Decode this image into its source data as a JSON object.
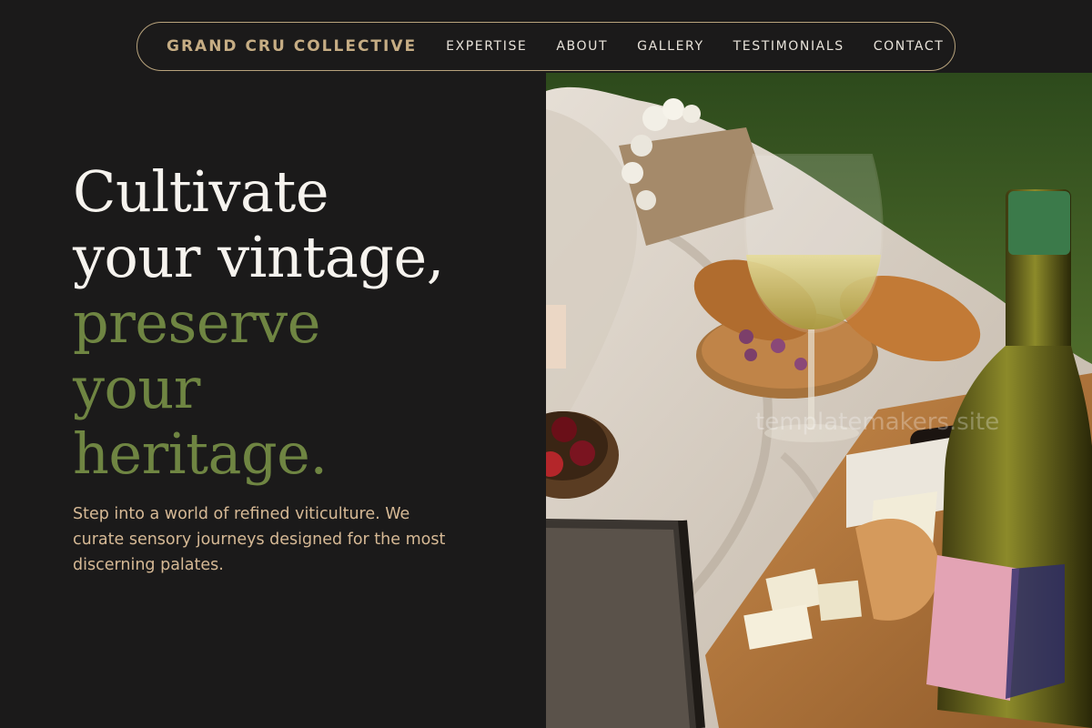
{
  "nav": {
    "brand": "GRAND CRU COLLECTIVE",
    "links": [
      "EXPERTISE",
      "ABOUT",
      "GALLERY",
      "TESTIMONIALS",
      "CONTACT"
    ]
  },
  "hero": {
    "headline_white": [
      "Cultivate",
      "your vintage,"
    ],
    "headline_green": [
      "preserve",
      "your",
      "heritage."
    ],
    "subtext": "Step into a world of refined viticulture. We curate sensory journeys designed for the most discerning palates."
  },
  "photo": {
    "watermark": "templatemakers.site"
  },
  "colors": {
    "background": "#1b1a1a",
    "accent_gold": "#c6ad84",
    "accent_green": "#6f8542",
    "subtext": "#d6b995"
  }
}
